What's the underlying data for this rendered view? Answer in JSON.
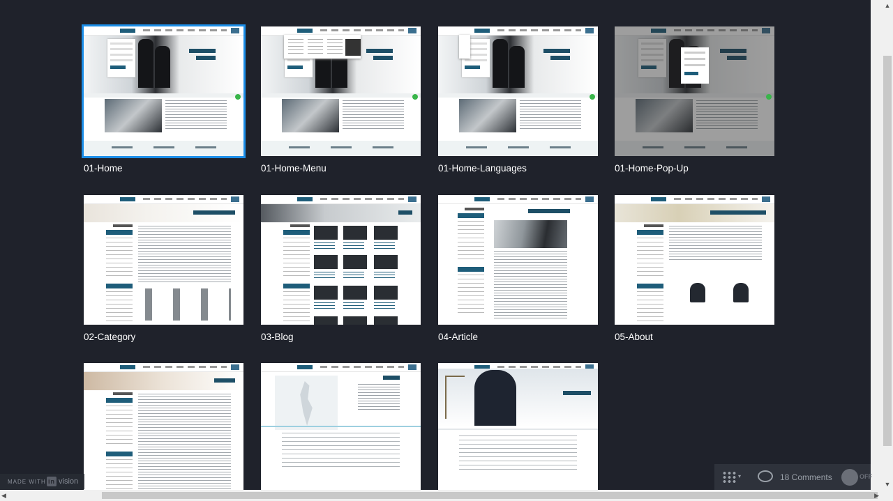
{
  "screens": [
    {
      "title": "01-Home",
      "selected": true
    },
    {
      "title": "01-Home-Menu"
    },
    {
      "title": "01-Home-Languages"
    },
    {
      "title": "01-Home-Pop-Up"
    },
    {
      "title": "02-Category"
    },
    {
      "title": "03-Blog"
    },
    {
      "title": "04-Article"
    },
    {
      "title": "05-About"
    },
    {
      "title": ""
    },
    {
      "title": ""
    },
    {
      "title": ""
    }
  ],
  "branding": {
    "made_with": "MADE WITH",
    "badge": "in",
    "word": "vision"
  },
  "toolbar": {
    "grid_icon": "grid-icon",
    "comments_label": "18 Comments",
    "toggle_state": "OFF"
  },
  "colors": {
    "background": "#1f222b",
    "selected_outline": "#1b8ee8",
    "toolbar": "#2e323b"
  }
}
